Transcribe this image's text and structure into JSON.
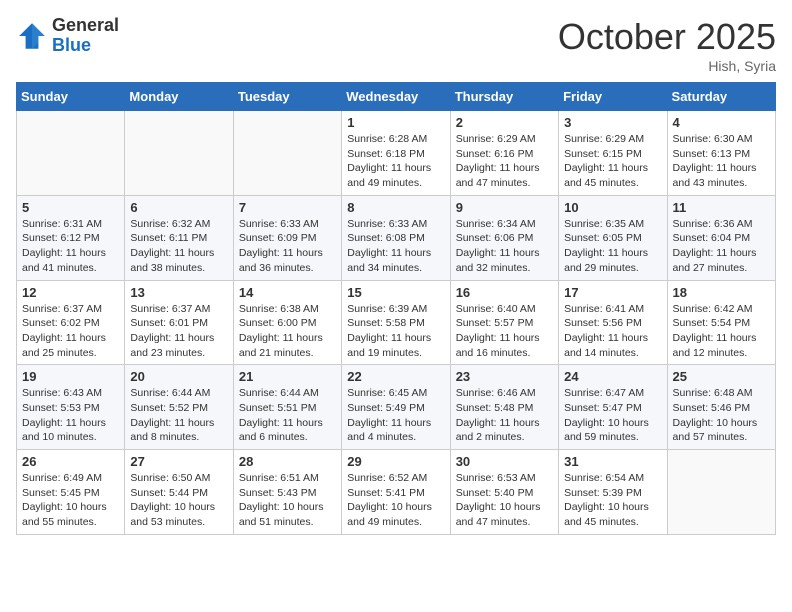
{
  "header": {
    "logo_general": "General",
    "logo_blue": "Blue",
    "month_title": "October 2025",
    "subtitle": "Hish, Syria"
  },
  "days_of_week": [
    "Sunday",
    "Monday",
    "Tuesday",
    "Wednesday",
    "Thursday",
    "Friday",
    "Saturday"
  ],
  "weeks": [
    [
      {
        "day": "",
        "content": ""
      },
      {
        "day": "",
        "content": ""
      },
      {
        "day": "",
        "content": ""
      },
      {
        "day": "1",
        "content": "Sunrise: 6:28 AM\nSunset: 6:18 PM\nDaylight: 11 hours and 49 minutes."
      },
      {
        "day": "2",
        "content": "Sunrise: 6:29 AM\nSunset: 6:16 PM\nDaylight: 11 hours and 47 minutes."
      },
      {
        "day": "3",
        "content": "Sunrise: 6:29 AM\nSunset: 6:15 PM\nDaylight: 11 hours and 45 minutes."
      },
      {
        "day": "4",
        "content": "Sunrise: 6:30 AM\nSunset: 6:13 PM\nDaylight: 11 hours and 43 minutes."
      }
    ],
    [
      {
        "day": "5",
        "content": "Sunrise: 6:31 AM\nSunset: 6:12 PM\nDaylight: 11 hours and 41 minutes."
      },
      {
        "day": "6",
        "content": "Sunrise: 6:32 AM\nSunset: 6:11 PM\nDaylight: 11 hours and 38 minutes."
      },
      {
        "day": "7",
        "content": "Sunrise: 6:33 AM\nSunset: 6:09 PM\nDaylight: 11 hours and 36 minutes."
      },
      {
        "day": "8",
        "content": "Sunrise: 6:33 AM\nSunset: 6:08 PM\nDaylight: 11 hours and 34 minutes."
      },
      {
        "day": "9",
        "content": "Sunrise: 6:34 AM\nSunset: 6:06 PM\nDaylight: 11 hours and 32 minutes."
      },
      {
        "day": "10",
        "content": "Sunrise: 6:35 AM\nSunset: 6:05 PM\nDaylight: 11 hours and 29 minutes."
      },
      {
        "day": "11",
        "content": "Sunrise: 6:36 AM\nSunset: 6:04 PM\nDaylight: 11 hours and 27 minutes."
      }
    ],
    [
      {
        "day": "12",
        "content": "Sunrise: 6:37 AM\nSunset: 6:02 PM\nDaylight: 11 hours and 25 minutes."
      },
      {
        "day": "13",
        "content": "Sunrise: 6:37 AM\nSunset: 6:01 PM\nDaylight: 11 hours and 23 minutes."
      },
      {
        "day": "14",
        "content": "Sunrise: 6:38 AM\nSunset: 6:00 PM\nDaylight: 11 hours and 21 minutes."
      },
      {
        "day": "15",
        "content": "Sunrise: 6:39 AM\nSunset: 5:58 PM\nDaylight: 11 hours and 19 minutes."
      },
      {
        "day": "16",
        "content": "Sunrise: 6:40 AM\nSunset: 5:57 PM\nDaylight: 11 hours and 16 minutes."
      },
      {
        "day": "17",
        "content": "Sunrise: 6:41 AM\nSunset: 5:56 PM\nDaylight: 11 hours and 14 minutes."
      },
      {
        "day": "18",
        "content": "Sunrise: 6:42 AM\nSunset: 5:54 PM\nDaylight: 11 hours and 12 minutes."
      }
    ],
    [
      {
        "day": "19",
        "content": "Sunrise: 6:43 AM\nSunset: 5:53 PM\nDaylight: 11 hours and 10 minutes."
      },
      {
        "day": "20",
        "content": "Sunrise: 6:44 AM\nSunset: 5:52 PM\nDaylight: 11 hours and 8 minutes."
      },
      {
        "day": "21",
        "content": "Sunrise: 6:44 AM\nSunset: 5:51 PM\nDaylight: 11 hours and 6 minutes."
      },
      {
        "day": "22",
        "content": "Sunrise: 6:45 AM\nSunset: 5:49 PM\nDaylight: 11 hours and 4 minutes."
      },
      {
        "day": "23",
        "content": "Sunrise: 6:46 AM\nSunset: 5:48 PM\nDaylight: 11 hours and 2 minutes."
      },
      {
        "day": "24",
        "content": "Sunrise: 6:47 AM\nSunset: 5:47 PM\nDaylight: 10 hours and 59 minutes."
      },
      {
        "day": "25",
        "content": "Sunrise: 6:48 AM\nSunset: 5:46 PM\nDaylight: 10 hours and 57 minutes."
      }
    ],
    [
      {
        "day": "26",
        "content": "Sunrise: 6:49 AM\nSunset: 5:45 PM\nDaylight: 10 hours and 55 minutes."
      },
      {
        "day": "27",
        "content": "Sunrise: 6:50 AM\nSunset: 5:44 PM\nDaylight: 10 hours and 53 minutes."
      },
      {
        "day": "28",
        "content": "Sunrise: 6:51 AM\nSunset: 5:43 PM\nDaylight: 10 hours and 51 minutes."
      },
      {
        "day": "29",
        "content": "Sunrise: 6:52 AM\nSunset: 5:41 PM\nDaylight: 10 hours and 49 minutes."
      },
      {
        "day": "30",
        "content": "Sunrise: 6:53 AM\nSunset: 5:40 PM\nDaylight: 10 hours and 47 minutes."
      },
      {
        "day": "31",
        "content": "Sunrise: 6:54 AM\nSunset: 5:39 PM\nDaylight: 10 hours and 45 minutes."
      },
      {
        "day": "",
        "content": ""
      }
    ]
  ]
}
